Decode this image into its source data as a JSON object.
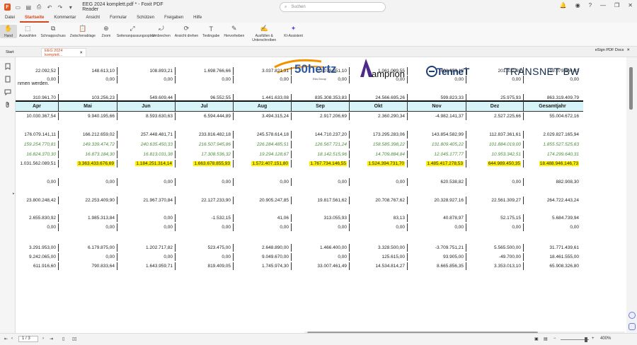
{
  "titlebar": {
    "doc_title": "EEG 2024 komplett.pdf * - Foxit PDF Reader",
    "search_placeholder": "Suchen"
  },
  "menu": [
    "Datei",
    "Startseite",
    "Kommentar",
    "Ansicht",
    "Formular",
    "Schützen",
    "Freigaben",
    "Hilfe"
  ],
  "menu_active_index": 1,
  "ribbon": [
    "Hand",
    "Auswählen",
    "Schnappschuss",
    "Zwischenablage",
    "Zoom",
    "Seitenanpassungsoption",
    "Umbrechen",
    "Ansicht drehen",
    "Textingabe",
    "Hervorheben",
    "Ausfüllen & Unterschreiben",
    "KI-Assistent"
  ],
  "tabs": {
    "start": "Start",
    "doc": "EEG 2024 komplett..."
  },
  "esign_label": "eSign PDF Docs",
  "logos": {
    "hertz": "50hertz",
    "hertz_sub": "Elia Group",
    "amprion": "amprion",
    "tennet": "TenneT",
    "transnet": "TRANSNET BW"
  },
  "intro_text": "nmen werden.",
  "table": {
    "headers": [
      "Apr",
      "Mai",
      "Jun",
      "Jul",
      "Aug",
      "Sep",
      "Okt",
      "Nov",
      "Dez",
      "Gesamtjahr"
    ],
    "rows": [
      {
        "style": "normal",
        "values": [
          "22.092,52",
          "148.613,10",
          "108.893,21",
          "1.698.766,66",
          "3.037.821,31",
          "-23.078.951,10",
          "1.061.099,55",
          "406.959,10",
          "201.332,98",
          "-19.079.964,63"
        ]
      },
      {
        "style": "normal",
        "values": [
          "0,00",
          "0,00",
          "0,00",
          "0,00",
          "0,00",
          "0,00",
          "0,00",
          "0,00",
          "0,00",
          "0,00"
        ]
      },
      {
        "style": "normal",
        "values": [
          "310.961,70",
          "103.256,23",
          "549.609,44",
          "96.552,55",
          "1.441.633,08",
          "835.308.353,83",
          "24.566.695,26",
          "599.823,33",
          "25.975,93",
          "863.319.409,79"
        ]
      },
      {
        "style": "normal",
        "values": [
          "10.030.367,54",
          "9.940.195,66",
          "8.593.630,63",
          "6.594.444,89",
          "3.494.315,24",
          "2.917.206,69",
          "2.360.290,34",
          "-4.982.141,37",
          "2.527.225,66",
          "55.004.672,16"
        ]
      },
      {
        "style": "normal",
        "values": [
          "176.079.141,11",
          "166.212.659,02",
          "257.448.481,71",
          "233.816.482,18",
          "245.578.614,18",
          "144.710.237,20",
          "173.295.283,06",
          "143.854.582,99",
          "112.837.361,61",
          "2.029.827.165,94"
        ]
      },
      {
        "style": "italic",
        "values": [
          "159.254.770,81",
          "149.339.474,72",
          "240.635.450,33",
          "216.507.945,86",
          "226.284.485,51",
          "126.567.721,24",
          "158.585.398,22",
          "131.809.405,22",
          "101.884.019,00",
          "1.855.527.525,63"
        ]
      },
      {
        "style": "italic",
        "values": [
          "16.824.370,30",
          "16.873.184,30",
          "16.813.031,38",
          "17.308.536,32",
          "19.294.128,67",
          "18.142.515,96",
          "14.709.884,84",
          "12.045.177,77",
          "10.953.342,51",
          "174.299.640,31"
        ]
      },
      {
        "style": "highlight",
        "values": [
          "1.031.562.089,51",
          "3.363.433.676,69",
          "1.184.251.314,14",
          "1.663.678.855,93",
          "1.572.407.151,80",
          "1.767.734.146,55",
          "1.524.394.731,70",
          "1.485.417.278,53",
          "644.989.450,35",
          "18.488.946.146,73"
        ]
      },
      {
        "style": "normal",
        "values": [
          "0,00",
          "0,00",
          "0,00",
          "0,00",
          "0,00",
          "0,00",
          "0,00",
          "620.538,82",
          "0,00",
          "882.908,30"
        ]
      },
      {
        "style": "normal",
        "values": [
          "23.800.248,42",
          "22.253.409,90",
          "21.967.370,84",
          "22.127.233,90",
          "20.905.247,85",
          "19.817.561,62",
          "20.708.767,62",
          "20.328.927,16",
          "22.561.309,27",
          "264.722.443,24"
        ]
      },
      {
        "style": "normal",
        "values": [
          "2.655.830,92",
          "1.985.313,84",
          "0,00",
          "-1.532,15",
          "41,06",
          "313.055,93",
          "83,13",
          "40.878,97",
          "52.175,15",
          "5.684.739,94"
        ]
      },
      {
        "style": "normal",
        "values": [
          "0,00",
          "0,00",
          "0,00",
          "0,00",
          "0,00",
          "0,00",
          "0,00",
          "0,00",
          "0,00",
          "0,00"
        ]
      },
      {
        "style": "normal",
        "values": [
          "3.291.953,00",
          "6.179.875,00",
          "1.202.717,82",
          "523.475,00",
          "2.648.890,00",
          "1.466.400,00",
          "3.328.500,00",
          "-3.709.751,21",
          "5.565.500,00",
          "31.771.439,61"
        ]
      },
      {
        "style": "normal",
        "values": [
          "9.242.065,00",
          "0,00",
          "0,00",
          "0,00",
          "9.049.670,00",
          "0,00",
          "125.615,00",
          "93.905,00",
          "-49.700,00",
          "18.461.555,00"
        ]
      },
      {
        "style": "normal",
        "values": [
          "611.916,60",
          "790.833,64",
          "1.643.959,71",
          "819.409,05",
          "1.745.974,30",
          "33.007.461,49",
          "14.534.814,27",
          "8.665.856,35",
          "3.353.013,10",
          "65.908.326,80"
        ]
      }
    ]
  },
  "status": {
    "page_value": "1 / 3",
    "zoom": "400%"
  },
  "colors": {
    "accent": "#d2461d",
    "header_bg": "#d6f3f7",
    "highlight": "#fff200",
    "italic_green": "#4b8b3b"
  }
}
